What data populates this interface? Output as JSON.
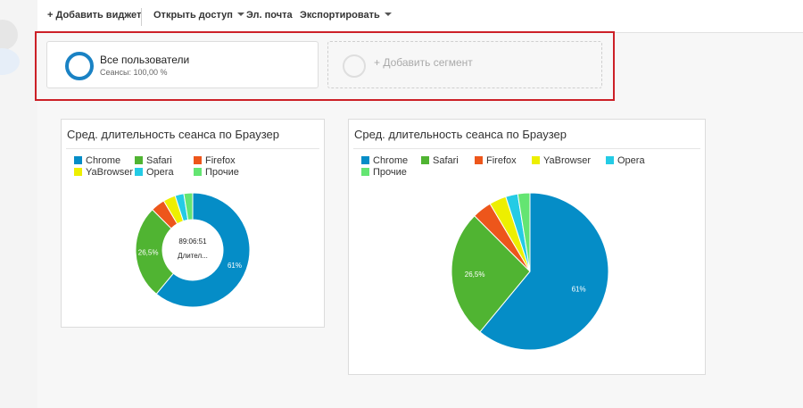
{
  "toolbar": {
    "add_widget": "+ Добавить виджет",
    "share": "Открыть доступ",
    "email": "Эл. почта",
    "export": "Экспортировать"
  },
  "segments": {
    "active": {
      "title": "Все пользователи",
      "subtitle": "Сеансы: 100,00 %",
      "ring_color": "#1a82c4"
    },
    "add_label": "+ Добавить сегмент"
  },
  "widgets": [
    {
      "title": "Сред. длительность сеанса по Браузер",
      "center_value": "89:06:51",
      "center_label": "Длител..."
    },
    {
      "title": "Сред. длительность сеанса по Браузер"
    }
  ],
  "chart_data": [
    {
      "type": "pie",
      "variant": "donut",
      "title": "Сред. длительность сеанса по Браузер",
      "categories": [
        "Chrome",
        "Safari",
        "Firefox",
        "YaBrowser",
        "Opera",
        "Прочие"
      ],
      "values": [
        61,
        26.5,
        4,
        3.5,
        2.5,
        2.5
      ],
      "colors": [
        "#058dc7",
        "#50b432",
        "#ed561b",
        "#edef00",
        "#24cbe5",
        "#64e572"
      ],
      "data_labels": [
        "61%",
        "26,5%",
        "",
        "",
        "",
        ""
      ],
      "legend_position": "top"
    },
    {
      "type": "pie",
      "title": "Сред. длительность сеанса по Браузер",
      "categories": [
        "Chrome",
        "Safari",
        "Firefox",
        "YaBrowser",
        "Opera",
        "Прочие"
      ],
      "values": [
        61,
        26.5,
        4,
        3.5,
        2.5,
        2.5
      ],
      "colors": [
        "#058dc7",
        "#50b432",
        "#ed561b",
        "#edef00",
        "#24cbe5",
        "#64e572"
      ],
      "data_labels": [
        "61%",
        "26,5%",
        "",
        "",
        "",
        ""
      ],
      "legend_position": "top"
    }
  ]
}
